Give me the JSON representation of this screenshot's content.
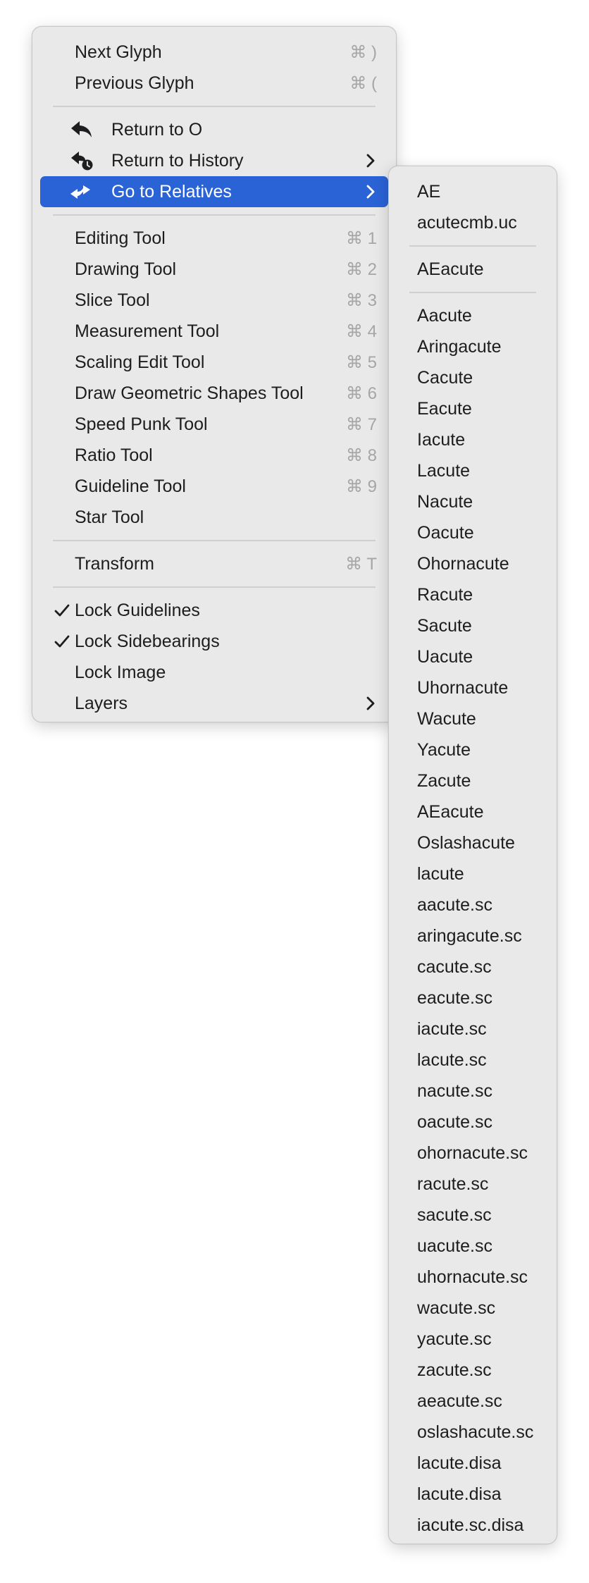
{
  "main_menu": {
    "next_glyph": {
      "label": "Next Glyph",
      "shortcut": "⌘ )"
    },
    "previous_glyph": {
      "label": "Previous Glyph",
      "shortcut": "⌘ ("
    },
    "return_to_o": {
      "label": "Return to O"
    },
    "return_to_history": {
      "label": "Return to History"
    },
    "go_to_relatives": {
      "label": "Go to Relatives"
    },
    "tools": [
      {
        "label": "Editing Tool",
        "shortcut": "⌘ 1"
      },
      {
        "label": "Drawing Tool",
        "shortcut": "⌘ 2"
      },
      {
        "label": "Slice Tool",
        "shortcut": "⌘ 3"
      },
      {
        "label": "Measurement Tool",
        "shortcut": "⌘ 4"
      },
      {
        "label": "Scaling Edit Tool",
        "shortcut": "⌘ 5"
      },
      {
        "label": "Draw Geometric Shapes Tool",
        "shortcut": "⌘ 6"
      },
      {
        "label": "Speed Punk Tool",
        "shortcut": "⌘ 7"
      },
      {
        "label": "Ratio Tool",
        "shortcut": "⌘ 8"
      },
      {
        "label": "Guideline Tool",
        "shortcut": "⌘ 9"
      },
      {
        "label": "Star Tool",
        "shortcut": ""
      }
    ],
    "transform": {
      "label": "Transform",
      "shortcut": "⌘ T"
    },
    "lock_guidelines": {
      "label": "Lock Guidelines",
      "checked": true
    },
    "lock_sidebearings": {
      "label": "Lock Sidebearings",
      "checked": true
    },
    "lock_image": {
      "label": "Lock Image",
      "checked": false
    },
    "layers": {
      "label": "Layers"
    }
  },
  "submenu": {
    "group1": [
      "AE",
      "acutecmb.uc"
    ],
    "group2": [
      "AEacute"
    ],
    "group3": [
      "Aacute",
      "Aringacute",
      "Cacute",
      "Eacute",
      "Iacute",
      "Lacute",
      "Nacute",
      "Oacute",
      "Ohornacute",
      "Racute",
      "Sacute",
      "Uacute",
      "Uhornacute",
      "Wacute",
      "Yacute",
      "Zacute",
      "AEacute",
      "Oslashacute",
      "lacute",
      "aacute.sc",
      "aringacute.sc",
      "cacute.sc",
      "eacute.sc",
      "iacute.sc",
      "lacute.sc",
      "nacute.sc",
      "oacute.sc",
      "ohornacute.sc",
      "racute.sc",
      "sacute.sc",
      "uacute.sc",
      "uhornacute.sc",
      "wacute.sc",
      "yacute.sc",
      "zacute.sc",
      "aeacute.sc",
      "oslashacute.sc",
      "lacute.disa",
      "lacute.disa",
      "iacute.sc.disa"
    ]
  },
  "colors": {
    "highlight": "#2a63d6",
    "menu_bg": "#e9e9e9",
    "shortcut_text": "#a6a6a6"
  }
}
